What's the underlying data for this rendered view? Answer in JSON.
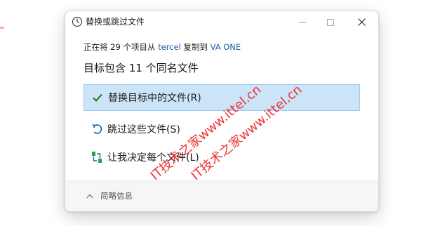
{
  "window": {
    "title": "替换或跳过文件",
    "icon": "clock-icon"
  },
  "status": {
    "prefix": "正在将 29 个项目从 ",
    "source": "tercel",
    "middle": " 复制到 ",
    "destination": "VA ONE"
  },
  "heading": "目标包含 11 个同名文件",
  "options": [
    {
      "label": "替换目标中的文件(R)",
      "icon": "checkmark-icon",
      "color": "#107c10"
    },
    {
      "label": "跳过这些文件(S)",
      "icon": "undo-arrow-icon",
      "color": "#1f5da8"
    },
    {
      "label": "让我决定每个文件(L)",
      "icon": "compare-arrows-icon",
      "color": "#1aa84a"
    }
  ],
  "footer": {
    "details_label": "简略信息"
  },
  "watermarks": [
    "IT技术之家www.ittel.cn",
    "IT技术之家www.ittel.cn"
  ],
  "colors": {
    "accent": "#0067c0",
    "selected_bg": "#cce4f7",
    "watermark": "#ef1d1d"
  }
}
